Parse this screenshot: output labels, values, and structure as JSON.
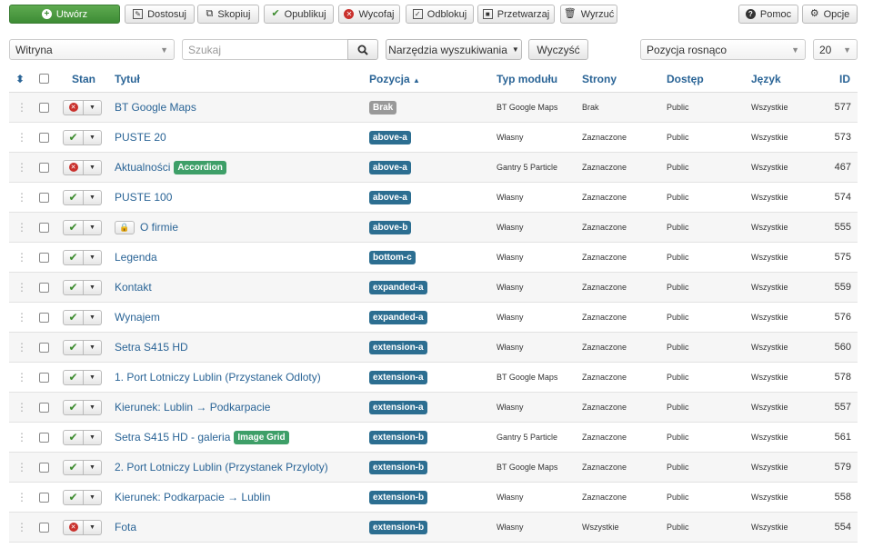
{
  "toolbar": {
    "create": "Utwórz",
    "edit": "Dostosuj",
    "copy": "Skopiuj",
    "publish": "Opublikuj",
    "unpublish": "Wycofaj",
    "checkin": "Odblokuj",
    "batch": "Przetwarzaj",
    "trash": "Wyrzuć",
    "help": "Pomoc",
    "options": "Opcje"
  },
  "filters": {
    "client": "Witryna",
    "search_placeholder": "Szukaj",
    "search_tools": "Narzędzia wyszukiwania",
    "clear": "Wyczyść",
    "ordering": "Pozycja rosnąco",
    "limit": "20"
  },
  "columns": {
    "status": "Stan",
    "title": "Tytuł",
    "position": "Pozycja",
    "type": "Typ modułu",
    "pages": "Strony",
    "access": "Dostęp",
    "language": "Język",
    "id": "ID"
  },
  "rows": [
    {
      "published": false,
      "title": "BT Google Maps",
      "badge": "",
      "locked": false,
      "position": "Brak",
      "position_style": "gray",
      "type": "BT Google Maps",
      "pages": "Brak",
      "access": "Public",
      "language": "Wszystkie",
      "id": "577"
    },
    {
      "published": true,
      "title": "PUSTE 20",
      "badge": "",
      "locked": false,
      "position": "above-a",
      "position_style": "pos",
      "type": "Własny",
      "pages": "Zaznaczone",
      "access": "Public",
      "language": "Wszystkie",
      "id": "573"
    },
    {
      "published": false,
      "title": "Aktualności",
      "badge": "Accordion",
      "locked": false,
      "position": "above-a",
      "position_style": "pos",
      "type": "Gantry 5 Particle",
      "pages": "Zaznaczone",
      "access": "Public",
      "language": "Wszystkie",
      "id": "467"
    },
    {
      "published": true,
      "title": "PUSTE 100",
      "badge": "",
      "locked": false,
      "position": "above-a",
      "position_style": "pos",
      "type": "Własny",
      "pages": "Zaznaczone",
      "access": "Public",
      "language": "Wszystkie",
      "id": "574"
    },
    {
      "published": true,
      "title": "O firmie",
      "badge": "",
      "locked": true,
      "position": "above-b",
      "position_style": "pos",
      "type": "Własny",
      "pages": "Zaznaczone",
      "access": "Public",
      "language": "Wszystkie",
      "id": "555"
    },
    {
      "published": true,
      "title": "Legenda",
      "badge": "",
      "locked": false,
      "position": "bottom-c",
      "position_style": "pos",
      "type": "Własny",
      "pages": "Zaznaczone",
      "access": "Public",
      "language": "Wszystkie",
      "id": "575"
    },
    {
      "published": true,
      "title": "Kontakt",
      "badge": "",
      "locked": false,
      "position": "expanded-a",
      "position_style": "pos",
      "type": "Własny",
      "pages": "Zaznaczone",
      "access": "Public",
      "language": "Wszystkie",
      "id": "559"
    },
    {
      "published": true,
      "title": "Wynajem",
      "badge": "",
      "locked": false,
      "position": "expanded-a",
      "position_style": "pos",
      "type": "Własny",
      "pages": "Zaznaczone",
      "access": "Public",
      "language": "Wszystkie",
      "id": "576"
    },
    {
      "published": true,
      "title": "Setra S415 HD",
      "badge": "",
      "locked": false,
      "position": "extension-a",
      "position_style": "pos",
      "type": "Własny",
      "pages": "Zaznaczone",
      "access": "Public",
      "language": "Wszystkie",
      "id": "560"
    },
    {
      "published": true,
      "title": "1. Port Lotniczy Lublin (Przystanek Odloty)",
      "badge": "",
      "locked": false,
      "position": "extension-a",
      "position_style": "pos",
      "type": "BT Google Maps",
      "pages": "Zaznaczone",
      "access": "Public",
      "language": "Wszystkie",
      "id": "578"
    },
    {
      "published": true,
      "title": "Kierunek: Lublin → Podkarpacie",
      "badge": "",
      "locked": false,
      "position": "extension-a",
      "position_style": "pos",
      "type": "Własny",
      "pages": "Zaznaczone",
      "access": "Public",
      "language": "Wszystkie",
      "id": "557"
    },
    {
      "published": true,
      "title": "Setra S415 HD - galeria",
      "badge": "Image Grid",
      "locked": false,
      "position": "extension-b",
      "position_style": "pos",
      "type": "Gantry 5 Particle",
      "pages": "Zaznaczone",
      "access": "Public",
      "language": "Wszystkie",
      "id": "561"
    },
    {
      "published": true,
      "title": "2. Port Lotniczy Lublin (Przystanek Przyloty)",
      "badge": "",
      "locked": false,
      "position": "extension-b",
      "position_style": "pos",
      "type": "BT Google Maps",
      "pages": "Zaznaczone",
      "access": "Public",
      "language": "Wszystkie",
      "id": "579"
    },
    {
      "published": true,
      "title": "Kierunek: Podkarpacie → Lublin",
      "badge": "",
      "locked": false,
      "position": "extension-b",
      "position_style": "pos",
      "type": "Własny",
      "pages": "Zaznaczone",
      "access": "Public",
      "language": "Wszystkie",
      "id": "558"
    },
    {
      "published": false,
      "title": "Fota",
      "badge": "",
      "locked": false,
      "position": "extension-b",
      "position_style": "pos",
      "type": "Własny",
      "pages": "Wszystkie",
      "access": "Public",
      "language": "Wszystkie",
      "id": "554"
    }
  ]
}
